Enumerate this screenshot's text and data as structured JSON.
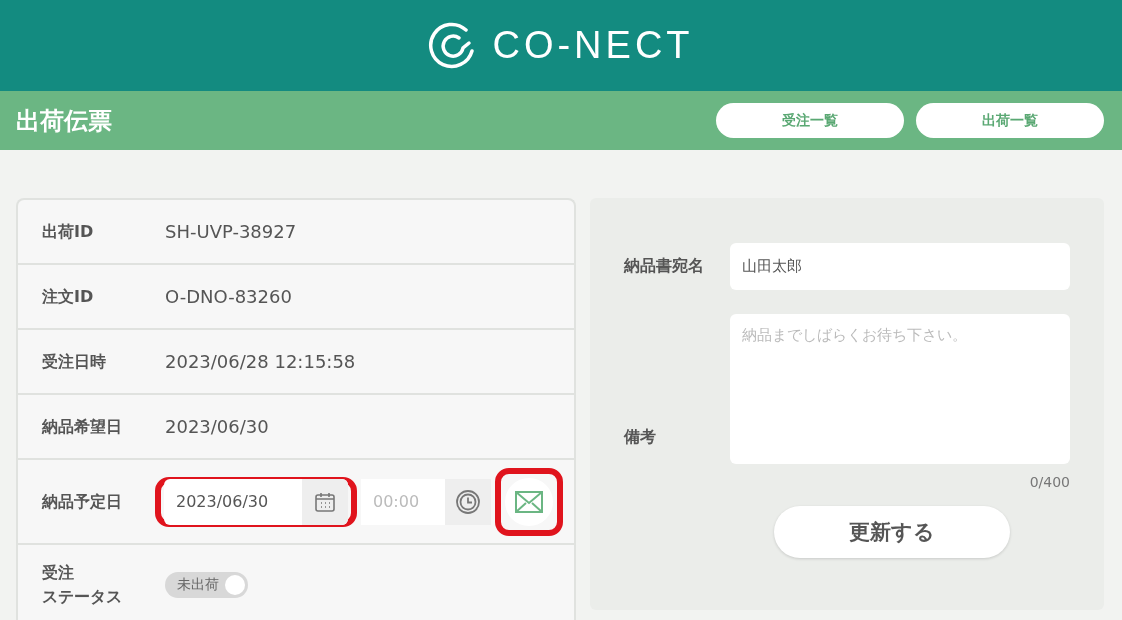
{
  "brand": {
    "name": "CO-NECT"
  },
  "page": {
    "title": "出荷伝票",
    "nav_buttons": [
      "受注一覧",
      "出荷一覧"
    ]
  },
  "details": [
    {
      "kind": "text",
      "label": "出荷ID",
      "value": "SH-UVP-38927"
    },
    {
      "kind": "text",
      "label": "注文ID",
      "value": "O-DNO-83260"
    },
    {
      "kind": "text",
      "label": "受注日時",
      "value": "2023/06/28 12:15:58"
    },
    {
      "kind": "text",
      "label": "納品希望日",
      "value": "2023/06/30"
    },
    {
      "kind": "datetime",
      "label": "納品予定日",
      "date": "2023/06/30",
      "date_highlighted": true,
      "time_placeholder": "00:00",
      "mail_highlighted": true
    },
    {
      "kind": "toggle",
      "label": [
        "受注",
        "ステータス"
      ],
      "toggle_label": "未出荷",
      "on": false
    }
  ],
  "form": {
    "addressee_label": "納品書宛名",
    "addressee_value": "山田太郎",
    "notes_label": "備考",
    "notes_placeholder": "納品までしばらくお待ち下さい。",
    "counter": "0/400",
    "submit": "更新する"
  }
}
